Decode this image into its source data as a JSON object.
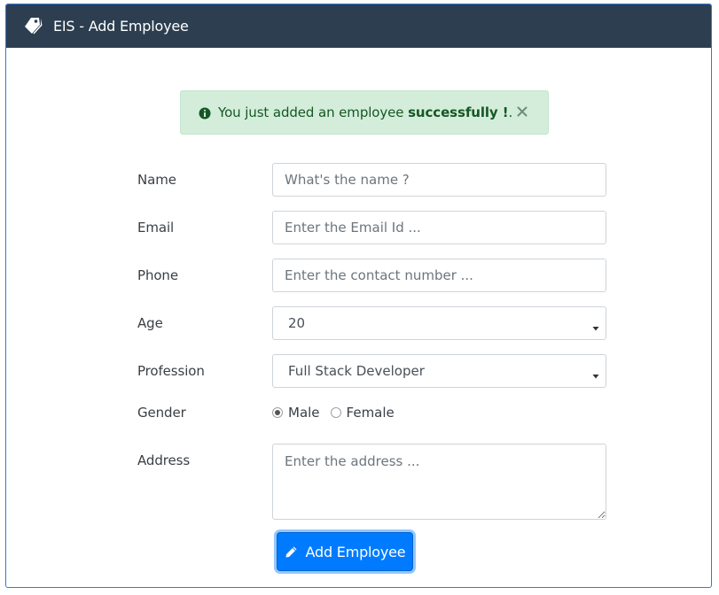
{
  "header": {
    "title": "EIS - Add Employee",
    "icon": "tags-icon"
  },
  "alert": {
    "icon": "info-circle-icon",
    "text_prefix": "You just added an employee ",
    "text_bold": "successfully !",
    "text_suffix": ".",
    "close": "×"
  },
  "form": {
    "name": {
      "label": "Name",
      "placeholder": "What's the name ?"
    },
    "email": {
      "label": "Email",
      "placeholder": "Enter the Email Id ..."
    },
    "phone": {
      "label": "Phone",
      "placeholder": "Enter the contact number ..."
    },
    "age": {
      "label": "Age",
      "value": "20"
    },
    "profession": {
      "label": "Profession",
      "value": "Full Stack Developer"
    },
    "gender": {
      "label": "Gender",
      "options": [
        "Male",
        "Female"
      ],
      "selected": "Male"
    },
    "address": {
      "label": "Address",
      "placeholder": "Enter the address ..."
    },
    "submit": {
      "label": "Add Employee",
      "icon": "pencil-icon"
    }
  },
  "colors": {
    "header_bg": "#2c3e50",
    "alert_bg": "#d4edda",
    "alert_text": "#155724",
    "primary": "#007bff"
  }
}
